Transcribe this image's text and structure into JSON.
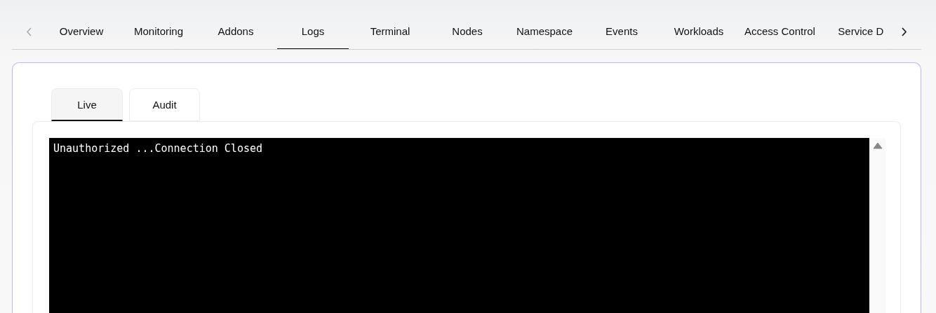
{
  "nav_tabs": [
    {
      "label": "Overview",
      "selected": false
    },
    {
      "label": "Monitoring",
      "selected": false
    },
    {
      "label": "Addons",
      "selected": false
    },
    {
      "label": "Logs",
      "selected": true
    },
    {
      "label": "Terminal",
      "selected": false
    },
    {
      "label": "Nodes",
      "selected": false
    },
    {
      "label": "Namespace",
      "selected": false
    },
    {
      "label": "Events",
      "selected": false
    },
    {
      "label": "Workloads",
      "selected": false
    },
    {
      "label": "Access Control",
      "selected": false
    },
    {
      "label": "Service D",
      "selected": false
    }
  ],
  "log_tabs": [
    {
      "label": "Live",
      "selected": true
    },
    {
      "label": "Audit",
      "selected": false
    }
  ],
  "terminal": {
    "lines": [
      "Unauthorized ...Connection Closed"
    ]
  }
}
